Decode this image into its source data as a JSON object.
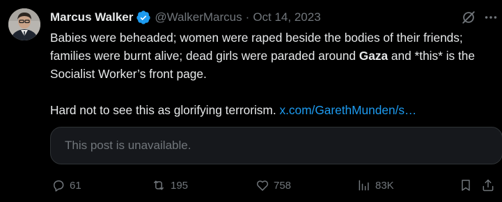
{
  "post": {
    "author": {
      "display_name": "Marcus Walker",
      "handle": "@WalkerMarcus",
      "verified": true,
      "avatar_icon": "profile-photo"
    },
    "separator": "·",
    "date": "Oct 14, 2023",
    "body": {
      "para1_part1": "Babies were beheaded; women were raped beside the bodies of their friends; families were burnt alive; dead girls were paraded around ",
      "para1_highlight": "Gaza",
      "para1_part2": " and *this* is the Socialist Worker’s front page.",
      "para2_text": "Hard not to see this as glorifying terrorism. ",
      "para2_link": "x.com/GarethMunden/s…"
    },
    "quote": {
      "text": "This post is unavailable."
    },
    "actions": {
      "replies": "61",
      "reposts": "195",
      "likes": "758",
      "views": "83K"
    }
  },
  "colors": {
    "background": "#000000",
    "text_primary": "#e7e9ea",
    "text_secondary": "#71767b",
    "link": "#1d9bf0",
    "verified_badge": "#1d9bf0",
    "card_bg": "#16181c",
    "card_border": "#2f3336"
  },
  "icons": {
    "verified": "verified-badge-icon",
    "grok": "grok-icon",
    "more": "more-options-icon",
    "reply": "reply-icon",
    "repost": "repost-icon",
    "like": "like-icon",
    "views": "views-icon",
    "bookmark": "bookmark-icon",
    "share": "share-icon"
  }
}
